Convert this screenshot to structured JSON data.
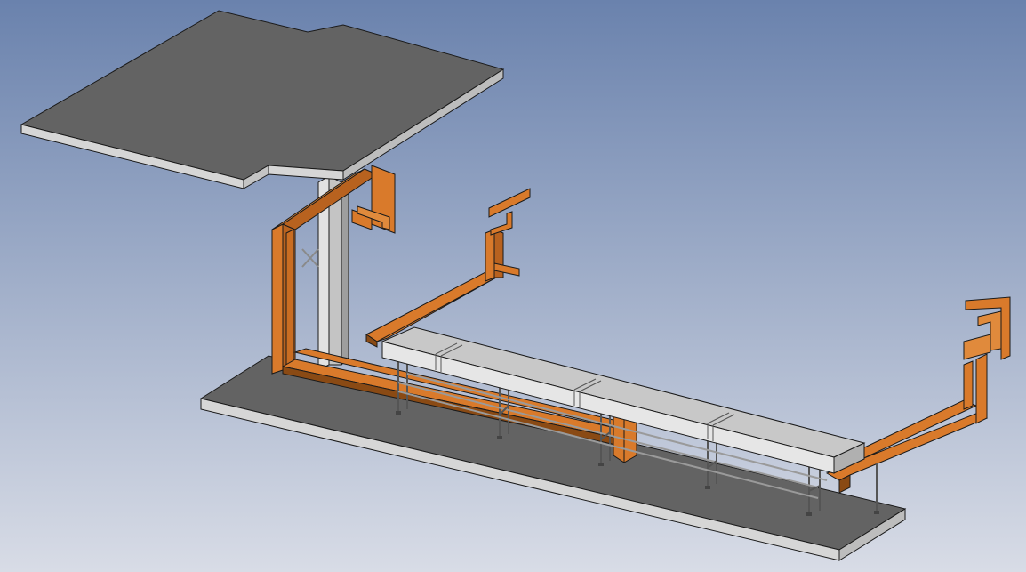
{
  "viewport": {
    "background_top": "#6a82ad",
    "background_bottom": "#d8dce6"
  },
  "colors": {
    "slab_top": "#636363",
    "slab_side": "#d6d6d6",
    "slab_edge": "#cfcfcf",
    "orange": "#d97a2b",
    "orange_dark": "#8a4a14",
    "conveyor_top": "#c8c8c8",
    "conveyor_side": "#e6e6e6",
    "frame": "#9a9a9a",
    "outline": "#1a1a1a"
  },
  "objects": [
    "upper-platform-slab",
    "floor-slab",
    "vertical-support-column",
    "orange-cable-duct-system",
    "conveyor-belt",
    "conveyor-leg-frames"
  ]
}
